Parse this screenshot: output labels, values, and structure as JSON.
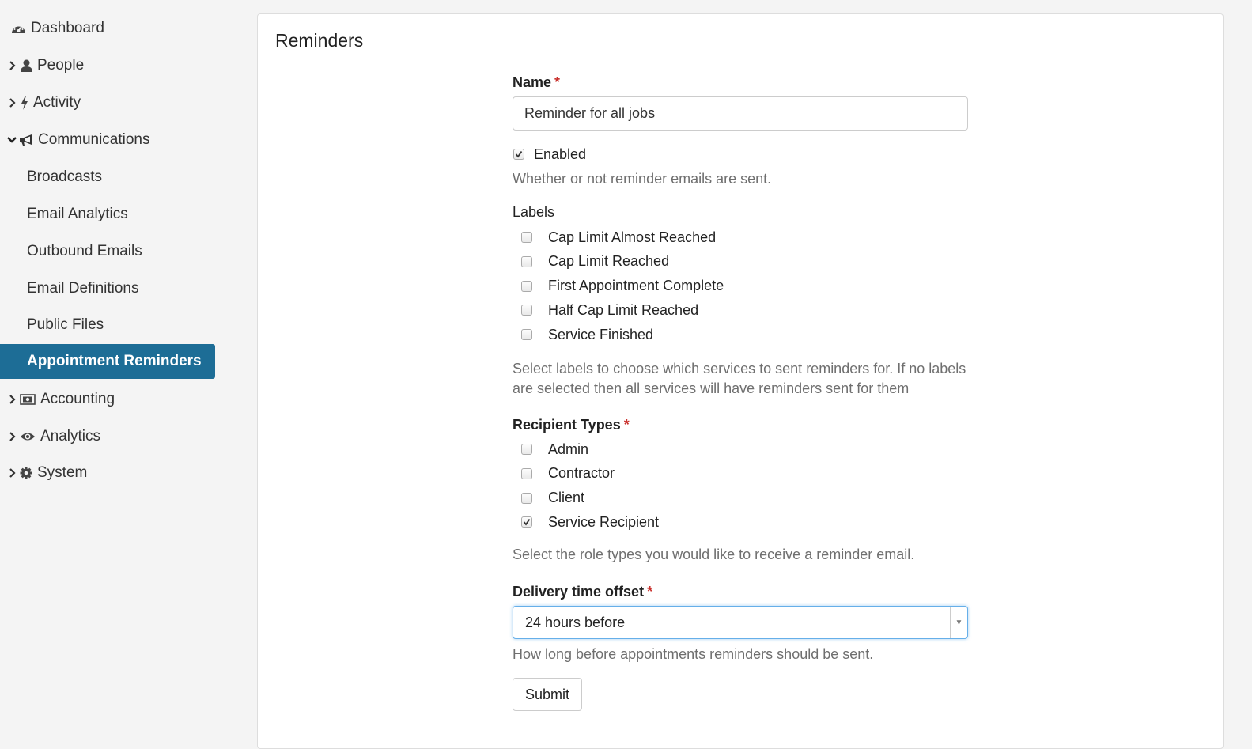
{
  "sidebar": {
    "items": [
      {
        "label": "Dashboard",
        "icon": "dashboard-icon"
      },
      {
        "label": "People",
        "icon": "user-icon",
        "chevron": "right"
      },
      {
        "label": "Activity",
        "icon": "bolt-icon",
        "chevron": "right"
      },
      {
        "label": "Communications",
        "icon": "bullhorn-icon",
        "chevron": "down"
      },
      {
        "label": "Accounting",
        "icon": "money-icon",
        "chevron": "right"
      },
      {
        "label": "Analytics",
        "icon": "eye-icon",
        "chevron": "right"
      },
      {
        "label": "System",
        "icon": "gear-icon",
        "chevron": "right"
      }
    ],
    "sub_items": [
      "Broadcasts",
      "Email Analytics",
      "Outbound Emails",
      "Email Definitions",
      "Public Files",
      "Appointment Reminders"
    ],
    "active": "Appointment Reminders",
    "active_color": "#1d6d96"
  },
  "panel": {
    "title": "Reminders"
  },
  "form": {
    "name": {
      "label": "Name",
      "required": "*",
      "value": "Reminder for all jobs"
    },
    "enabled": {
      "label": "Enabled",
      "checked": true,
      "help": "Whether or not reminder emails are sent."
    },
    "labels": {
      "title": "Labels",
      "options": [
        {
          "label": "Cap Limit Almost Reached",
          "checked": false
        },
        {
          "label": "Cap Limit Reached",
          "checked": false
        },
        {
          "label": "First Appointment Complete",
          "checked": false
        },
        {
          "label": "Half Cap Limit Reached",
          "checked": false
        },
        {
          "label": "Service Finished",
          "checked": false
        }
      ],
      "help_line1": "Select labels to choose which services to sent reminders for. If no labels",
      "help_line2": "are selected then all services will have reminders sent for them"
    },
    "recipient_types": {
      "label": "Recipient Types",
      "required": "*",
      "options": [
        {
          "label": "Admin",
          "checked": false
        },
        {
          "label": "Contractor",
          "checked": false
        },
        {
          "label": "Client",
          "checked": false
        },
        {
          "label": "Service Recipient",
          "checked": true
        }
      ],
      "help": "Select the role types you would like to receive a reminder email."
    },
    "delivery": {
      "label": "Delivery time offset",
      "required": "*",
      "value": "24 hours before",
      "help": "How long before appointments reminders should be sent."
    },
    "submit_label": "Submit"
  }
}
